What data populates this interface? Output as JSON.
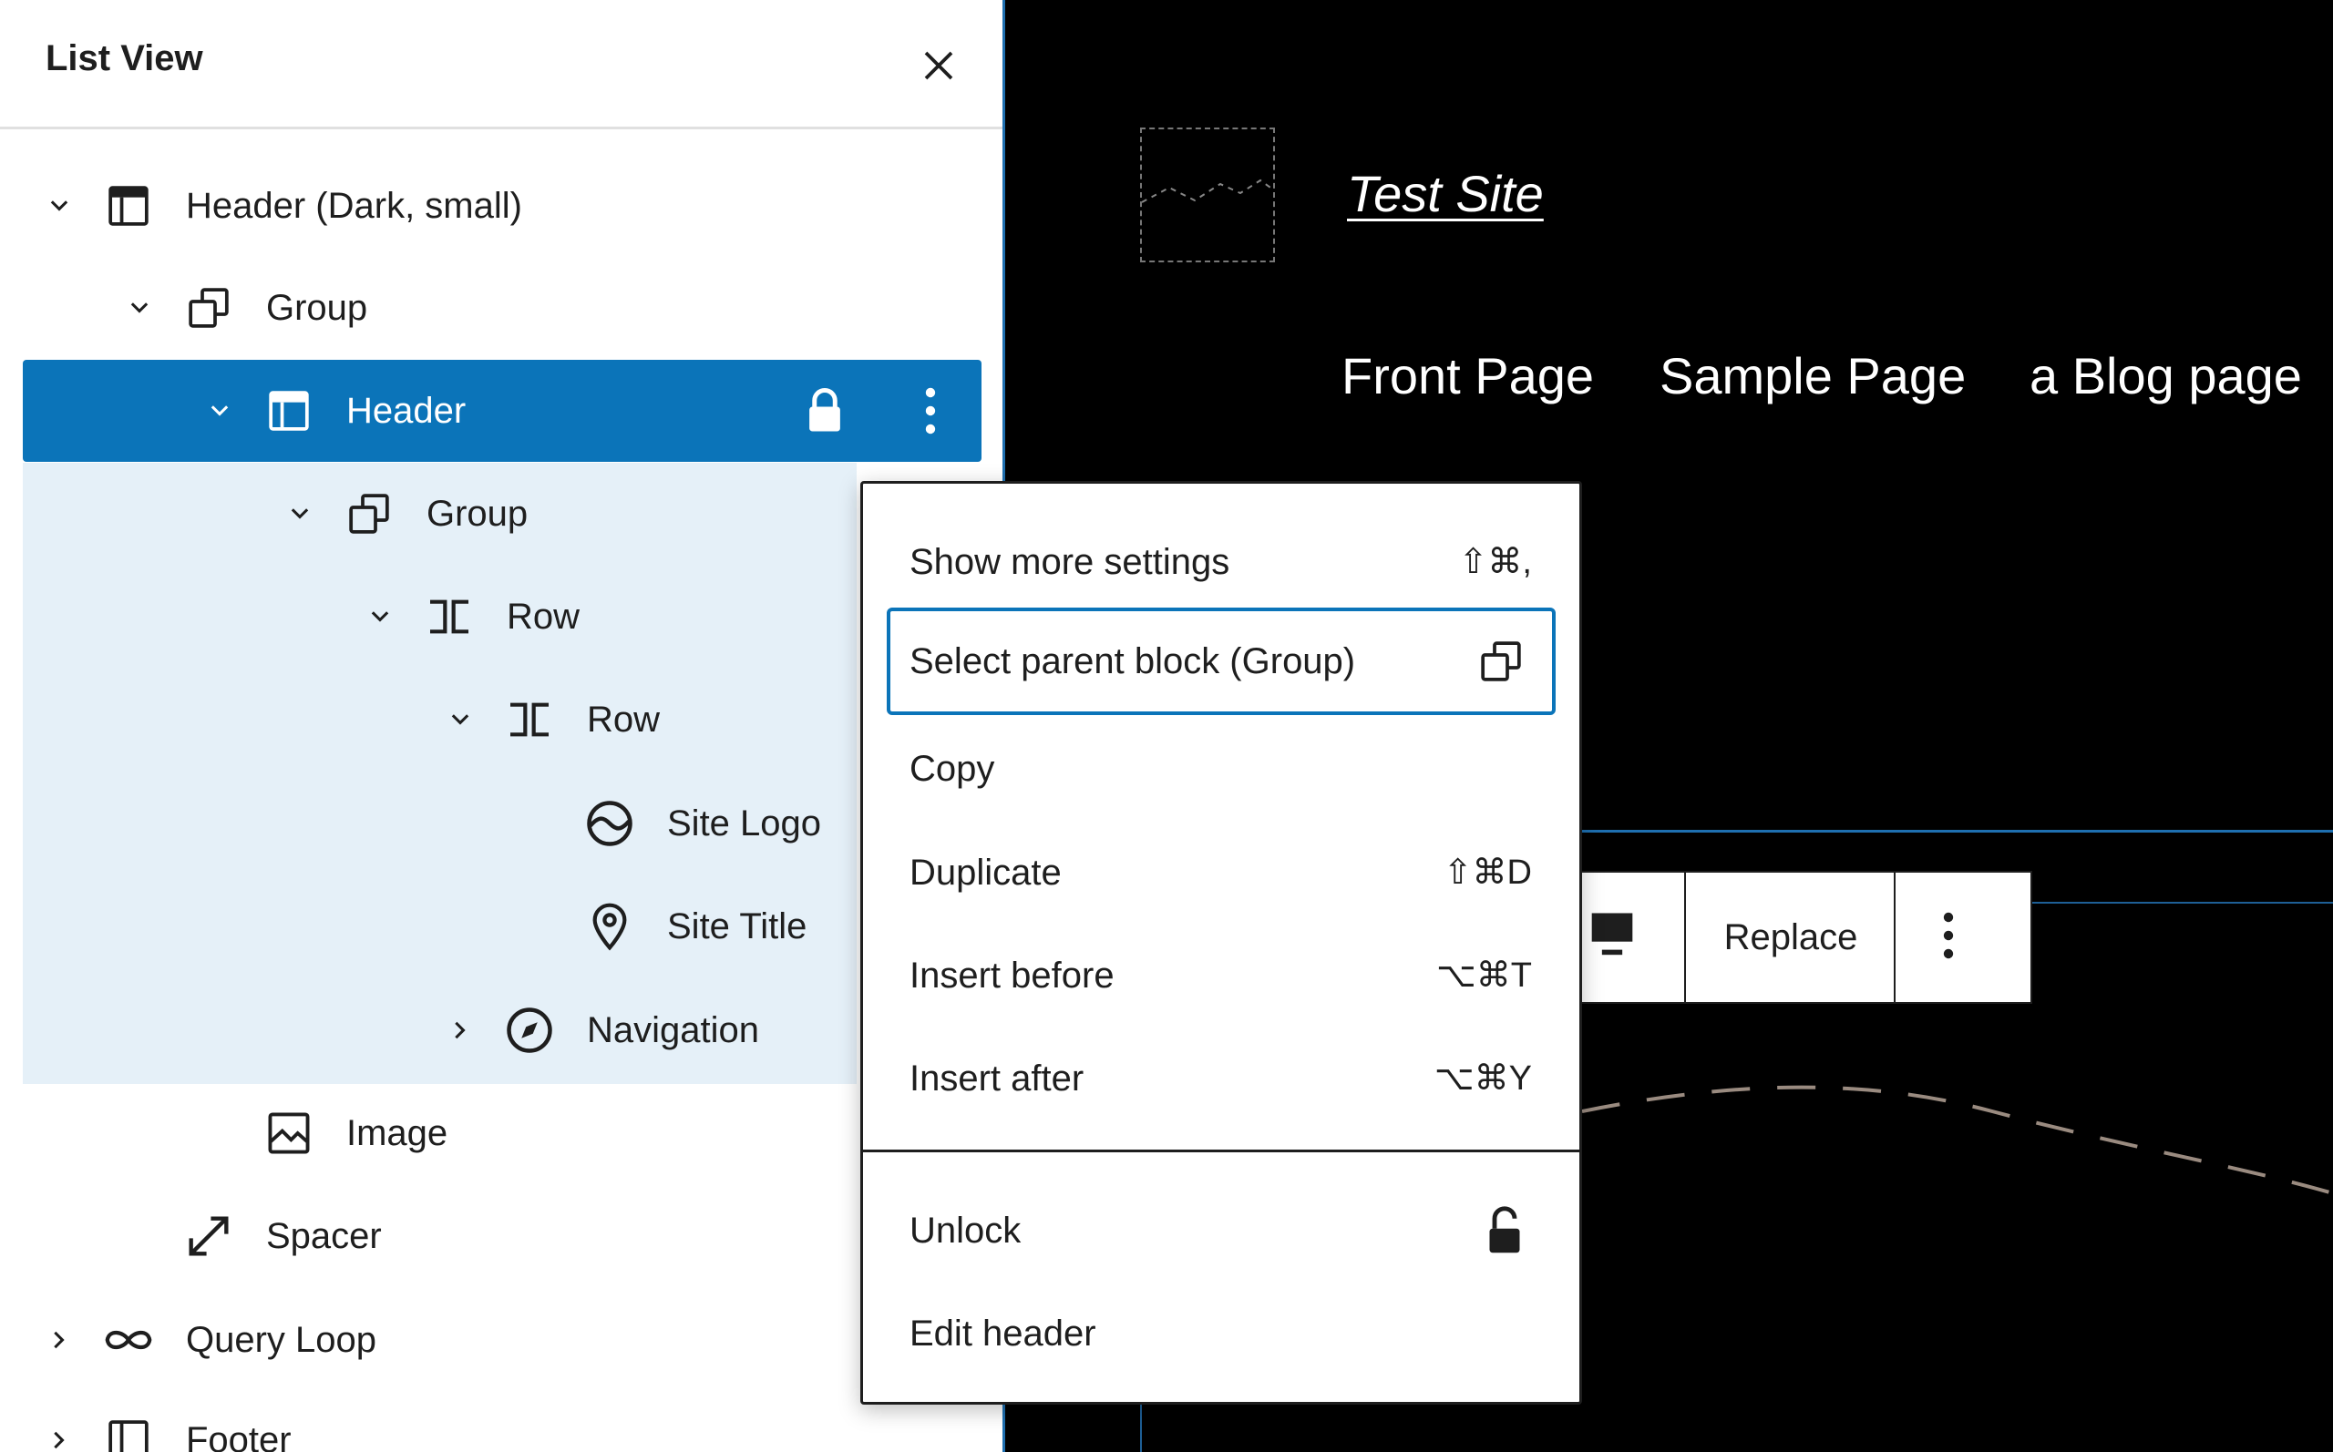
{
  "panel": {
    "title": "List View",
    "tree": [
      {
        "label": "Header (Dark, small)",
        "icon": "template-part-icon",
        "chevron": "down"
      },
      {
        "label": "Group",
        "icon": "group-icon",
        "chevron": "down"
      },
      {
        "label": "Header",
        "icon": "template-part-icon",
        "chevron": "down",
        "selected": true,
        "locked": true
      },
      {
        "label": "Group",
        "icon": "group-icon",
        "chevron": "down"
      },
      {
        "label": "Row",
        "icon": "row-icon",
        "chevron": "down"
      },
      {
        "label": "Row",
        "icon": "row-icon",
        "chevron": "down"
      },
      {
        "label": "Site Logo",
        "icon": "site-logo-icon"
      },
      {
        "label": "Site Title",
        "icon": "map-marker-icon"
      },
      {
        "label": "Navigation",
        "icon": "navigation-icon",
        "chevron": "right"
      },
      {
        "label": "Image",
        "icon": "image-icon"
      },
      {
        "label": "Spacer",
        "icon": "resize-icon"
      },
      {
        "label": "Query Loop",
        "icon": "loop-icon",
        "chevron": "right"
      },
      {
        "label": "Footer",
        "icon": "footer-icon",
        "chevron": "right"
      }
    ]
  },
  "canvas": {
    "site_title": "Test Site",
    "nav": [
      "Front Page",
      "Sample Page",
      "a Blog page"
    ]
  },
  "toolbar": {
    "replace_label": "Replace"
  },
  "menu": {
    "items": [
      {
        "label": "Show more settings",
        "shortcut": "⇧⌘,"
      },
      {
        "label": "Select parent block (Group)",
        "icon": "group-icon",
        "focused": true
      },
      {
        "label": "Copy",
        "shortcut": ""
      },
      {
        "label": "Duplicate",
        "shortcut": "⇧⌘D"
      },
      {
        "label": "Insert before",
        "shortcut": "⌥⌘T"
      },
      {
        "label": "Insert after",
        "shortcut": "⌥⌘Y"
      },
      {
        "label": "Unlock",
        "icon": "unlock-icon"
      },
      {
        "label": "Edit header",
        "shortcut": ""
      }
    ]
  },
  "colors": {
    "accent": "#0b74b9",
    "selected_tint": "#e5f0f8",
    "canvas_bg": "#000000"
  }
}
